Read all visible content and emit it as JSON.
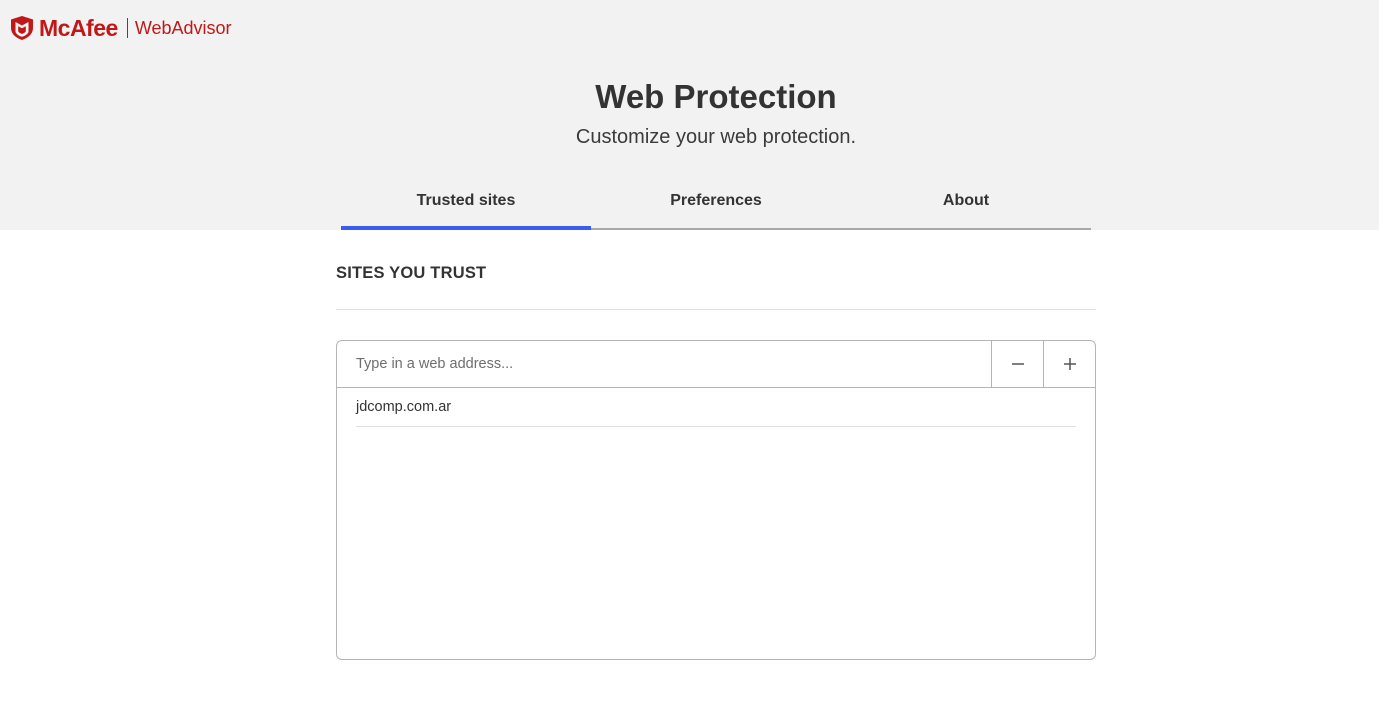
{
  "brand": {
    "name": "McAfee",
    "product": "WebAdvisor",
    "color": "#c01818"
  },
  "page": {
    "title": "Web Protection",
    "subtitle": "Customize your web protection."
  },
  "tabs": [
    {
      "label": "Trusted sites",
      "active": true
    },
    {
      "label": "Preferences",
      "active": false
    },
    {
      "label": "About",
      "active": false
    }
  ],
  "accent_color": "#3b5cf0",
  "trusted_sites": {
    "section_title": "SITES YOU TRUST",
    "input_placeholder": "Type in a web address...",
    "input_value": "",
    "remove_icon": "minus-icon",
    "add_icon": "plus-icon",
    "sites": [
      "jdcomp.com.ar"
    ]
  }
}
